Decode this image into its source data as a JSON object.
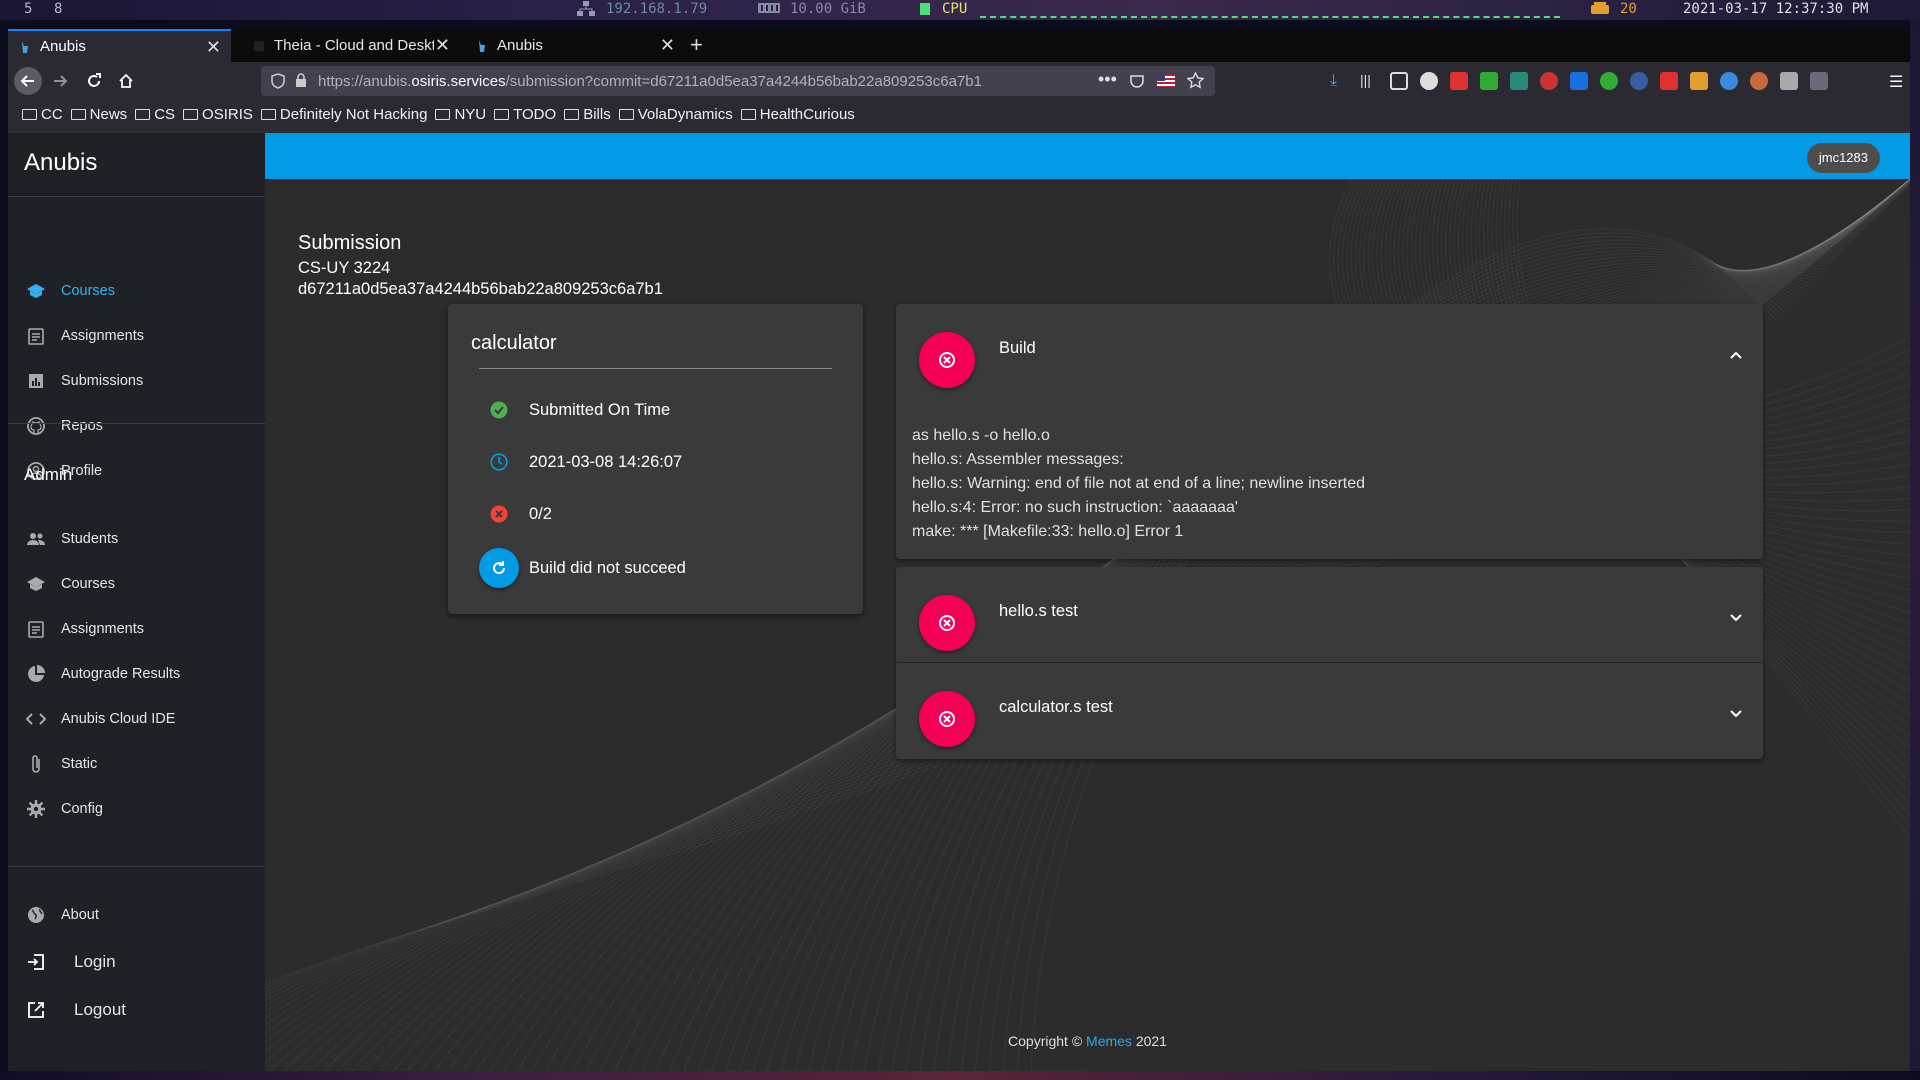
{
  "system_bar": {
    "workspace_a": "5",
    "workspace_b": "8",
    "ip": "192.168.1.79",
    "memory": "10.00 GiB",
    "cpu_label": "CPU",
    "updates": "20",
    "datetime": "2021-03-17 12:37:30 PM"
  },
  "browser": {
    "tabs": [
      {
        "label": "Anubis",
        "active": true
      },
      {
        "label": "Theia - Cloud and Desktop IDE",
        "active": false
      },
      {
        "label": "Anubis",
        "active": false
      }
    ],
    "url_prefix": "https://anubis.",
    "url_domain": "osiris.services",
    "url_path": "/submission?commit=d67211a0d5ea37a4244b56bab22a809253c6a7b1",
    "bookmarks": [
      "CC",
      "News",
      "CS",
      "OSIRIS",
      "Definitely Not Hacking",
      "NYU",
      "TODO",
      "Bills",
      "VolaDynamics",
      "HealthCurious"
    ]
  },
  "sidebar": {
    "brand": "Anubis",
    "main_items": [
      {
        "label": "Courses",
        "icon": "school-icon",
        "active": true
      },
      {
        "label": "Assignments",
        "icon": "assignment-icon"
      },
      {
        "label": "Submissions",
        "icon": "chart-icon"
      },
      {
        "label": "Repos",
        "icon": "github-icon"
      },
      {
        "label": "Profile",
        "icon": "profile-icon"
      }
    ],
    "admin_section": "Admin",
    "admin_items": [
      {
        "label": "Students",
        "icon": "people-icon"
      },
      {
        "label": "Courses",
        "icon": "school-icon"
      },
      {
        "label": "Assignments",
        "icon": "assignment-icon"
      },
      {
        "label": "Autograde Results",
        "icon": "pie-chart-icon"
      },
      {
        "label": "Anubis Cloud IDE",
        "icon": "code-icon"
      },
      {
        "label": "Static",
        "icon": "attachment-icon"
      },
      {
        "label": "Config",
        "icon": "gear-icon"
      }
    ],
    "footer_items": [
      {
        "label": "About",
        "icon": "globe-icon"
      },
      {
        "label": "Login",
        "icon": "login-icon"
      },
      {
        "label": "Logout",
        "icon": "logout-icon"
      }
    ]
  },
  "appbar": {
    "user": "jmc1283"
  },
  "submission": {
    "heading": "Submission",
    "course": "CS-UY 3224",
    "commit": "d67211a0d5ea37a4244b56bab22a809253c6a7b1",
    "assignment": "calculator",
    "rows": [
      {
        "text": "Submitted On Time",
        "icon": "check-circle-icon"
      },
      {
        "text": "2021-03-08 14:26:07",
        "icon": "clock-icon"
      },
      {
        "text": "0/2",
        "icon": "cancel-icon"
      },
      {
        "text": "Build did not succeed",
        "icon": "refresh-icon"
      }
    ]
  },
  "tests": [
    {
      "title": "Build",
      "expanded": true,
      "output": "as hello.s -o hello.o\nhello.s: Assembler messages:\nhello.s: Warning: end of file not at end of a line; newline inserted\nhello.s:4: Error: no such instruction: `aaaaaaa'\nmake: *** [Makefile:33: hello.o] Error 1"
    },
    {
      "title": "hello.s test",
      "expanded": false
    },
    {
      "title": "calculator.s test",
      "expanded": false
    }
  ],
  "footer": {
    "prefix": "Copyright © ",
    "link": "Memes",
    "suffix": " 2021"
  },
  "colors": {
    "accent": "#039be5",
    "error": "#f50057",
    "success": "#4caf50",
    "sidebar_active": "#38b1ef"
  }
}
